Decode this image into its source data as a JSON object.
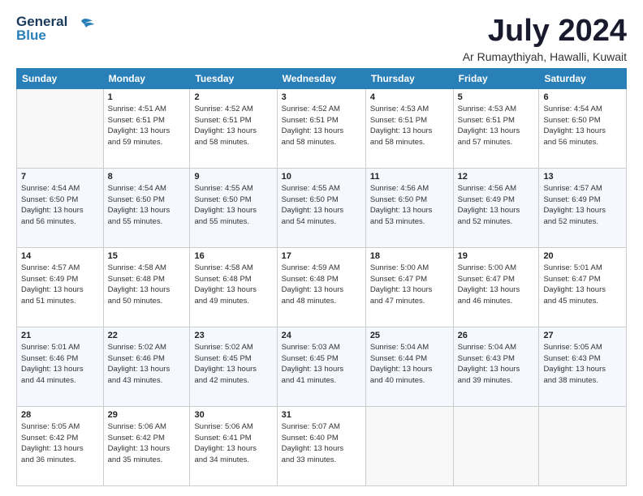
{
  "logo": {
    "line1": "General",
    "line2": "Blue"
  },
  "header": {
    "month": "July 2024",
    "location": "Ar Rumaythiyah, Hawalli, Kuwait"
  },
  "days_of_week": [
    "Sunday",
    "Monday",
    "Tuesday",
    "Wednesday",
    "Thursday",
    "Friday",
    "Saturday"
  ],
  "weeks": [
    [
      {
        "day": "",
        "info": ""
      },
      {
        "day": "1",
        "info": "Sunrise: 4:51 AM\nSunset: 6:51 PM\nDaylight: 13 hours\nand 59 minutes."
      },
      {
        "day": "2",
        "info": "Sunrise: 4:52 AM\nSunset: 6:51 PM\nDaylight: 13 hours\nand 58 minutes."
      },
      {
        "day": "3",
        "info": "Sunrise: 4:52 AM\nSunset: 6:51 PM\nDaylight: 13 hours\nand 58 minutes."
      },
      {
        "day": "4",
        "info": "Sunrise: 4:53 AM\nSunset: 6:51 PM\nDaylight: 13 hours\nand 58 minutes."
      },
      {
        "day": "5",
        "info": "Sunrise: 4:53 AM\nSunset: 6:51 PM\nDaylight: 13 hours\nand 57 minutes."
      },
      {
        "day": "6",
        "info": "Sunrise: 4:54 AM\nSunset: 6:50 PM\nDaylight: 13 hours\nand 56 minutes."
      }
    ],
    [
      {
        "day": "7",
        "info": "Sunrise: 4:54 AM\nSunset: 6:50 PM\nDaylight: 13 hours\nand 56 minutes."
      },
      {
        "day": "8",
        "info": "Sunrise: 4:54 AM\nSunset: 6:50 PM\nDaylight: 13 hours\nand 55 minutes."
      },
      {
        "day": "9",
        "info": "Sunrise: 4:55 AM\nSunset: 6:50 PM\nDaylight: 13 hours\nand 55 minutes."
      },
      {
        "day": "10",
        "info": "Sunrise: 4:55 AM\nSunset: 6:50 PM\nDaylight: 13 hours\nand 54 minutes."
      },
      {
        "day": "11",
        "info": "Sunrise: 4:56 AM\nSunset: 6:50 PM\nDaylight: 13 hours\nand 53 minutes."
      },
      {
        "day": "12",
        "info": "Sunrise: 4:56 AM\nSunset: 6:49 PM\nDaylight: 13 hours\nand 52 minutes."
      },
      {
        "day": "13",
        "info": "Sunrise: 4:57 AM\nSunset: 6:49 PM\nDaylight: 13 hours\nand 52 minutes."
      }
    ],
    [
      {
        "day": "14",
        "info": "Sunrise: 4:57 AM\nSunset: 6:49 PM\nDaylight: 13 hours\nand 51 minutes."
      },
      {
        "day": "15",
        "info": "Sunrise: 4:58 AM\nSunset: 6:48 PM\nDaylight: 13 hours\nand 50 minutes."
      },
      {
        "day": "16",
        "info": "Sunrise: 4:58 AM\nSunset: 6:48 PM\nDaylight: 13 hours\nand 49 minutes."
      },
      {
        "day": "17",
        "info": "Sunrise: 4:59 AM\nSunset: 6:48 PM\nDaylight: 13 hours\nand 48 minutes."
      },
      {
        "day": "18",
        "info": "Sunrise: 5:00 AM\nSunset: 6:47 PM\nDaylight: 13 hours\nand 47 minutes."
      },
      {
        "day": "19",
        "info": "Sunrise: 5:00 AM\nSunset: 6:47 PM\nDaylight: 13 hours\nand 46 minutes."
      },
      {
        "day": "20",
        "info": "Sunrise: 5:01 AM\nSunset: 6:47 PM\nDaylight: 13 hours\nand 45 minutes."
      }
    ],
    [
      {
        "day": "21",
        "info": "Sunrise: 5:01 AM\nSunset: 6:46 PM\nDaylight: 13 hours\nand 44 minutes."
      },
      {
        "day": "22",
        "info": "Sunrise: 5:02 AM\nSunset: 6:46 PM\nDaylight: 13 hours\nand 43 minutes."
      },
      {
        "day": "23",
        "info": "Sunrise: 5:02 AM\nSunset: 6:45 PM\nDaylight: 13 hours\nand 42 minutes."
      },
      {
        "day": "24",
        "info": "Sunrise: 5:03 AM\nSunset: 6:45 PM\nDaylight: 13 hours\nand 41 minutes."
      },
      {
        "day": "25",
        "info": "Sunrise: 5:04 AM\nSunset: 6:44 PM\nDaylight: 13 hours\nand 40 minutes."
      },
      {
        "day": "26",
        "info": "Sunrise: 5:04 AM\nSunset: 6:43 PM\nDaylight: 13 hours\nand 39 minutes."
      },
      {
        "day": "27",
        "info": "Sunrise: 5:05 AM\nSunset: 6:43 PM\nDaylight: 13 hours\nand 38 minutes."
      }
    ],
    [
      {
        "day": "28",
        "info": "Sunrise: 5:05 AM\nSunset: 6:42 PM\nDaylight: 13 hours\nand 36 minutes."
      },
      {
        "day": "29",
        "info": "Sunrise: 5:06 AM\nSunset: 6:42 PM\nDaylight: 13 hours\nand 35 minutes."
      },
      {
        "day": "30",
        "info": "Sunrise: 5:06 AM\nSunset: 6:41 PM\nDaylight: 13 hours\nand 34 minutes."
      },
      {
        "day": "31",
        "info": "Sunrise: 5:07 AM\nSunset: 6:40 PM\nDaylight: 13 hours\nand 33 minutes."
      },
      {
        "day": "",
        "info": ""
      },
      {
        "day": "",
        "info": ""
      },
      {
        "day": "",
        "info": ""
      }
    ]
  ]
}
